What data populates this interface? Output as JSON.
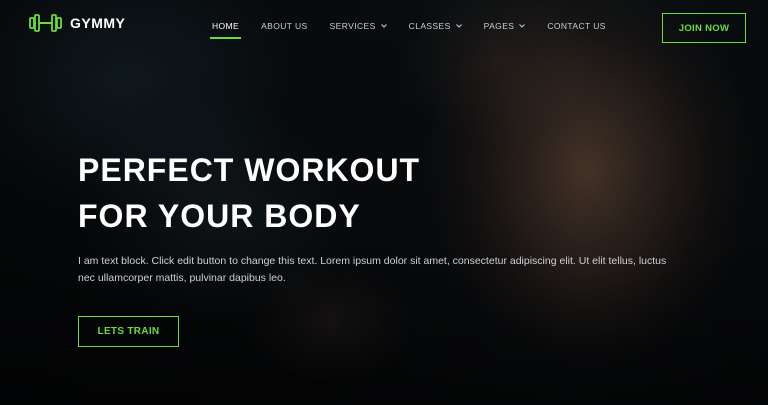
{
  "brand": {
    "name": "GYMMY",
    "logo_icon": "dumbbell-icon",
    "accent_color": "#6bdc3b"
  },
  "nav": {
    "items": [
      {
        "label": "HOME",
        "active": true,
        "has_dropdown": false
      },
      {
        "label": "ABOUT US",
        "active": false,
        "has_dropdown": false
      },
      {
        "label": "SERVICES",
        "active": false,
        "has_dropdown": true
      },
      {
        "label": "CLASSES",
        "active": false,
        "has_dropdown": true
      },
      {
        "label": "PAGES",
        "active": false,
        "has_dropdown": true
      },
      {
        "label": "CONTACT US",
        "active": false,
        "has_dropdown": false
      }
    ]
  },
  "header": {
    "join_label": "JOIN NOW"
  },
  "hero": {
    "headline_line1": "PERFECT WORKOUT",
    "headline_line2": "FOR YOUR BODY",
    "body": "I am text block. Click edit button to change this text. Lorem ipsum dolor sit amet, consectetur adipiscing elit. Ut elit tellus, luctus nec ullamcorper mattis, pulvinar dapibus leo.",
    "cta_label": "LETS TRAIN"
  }
}
